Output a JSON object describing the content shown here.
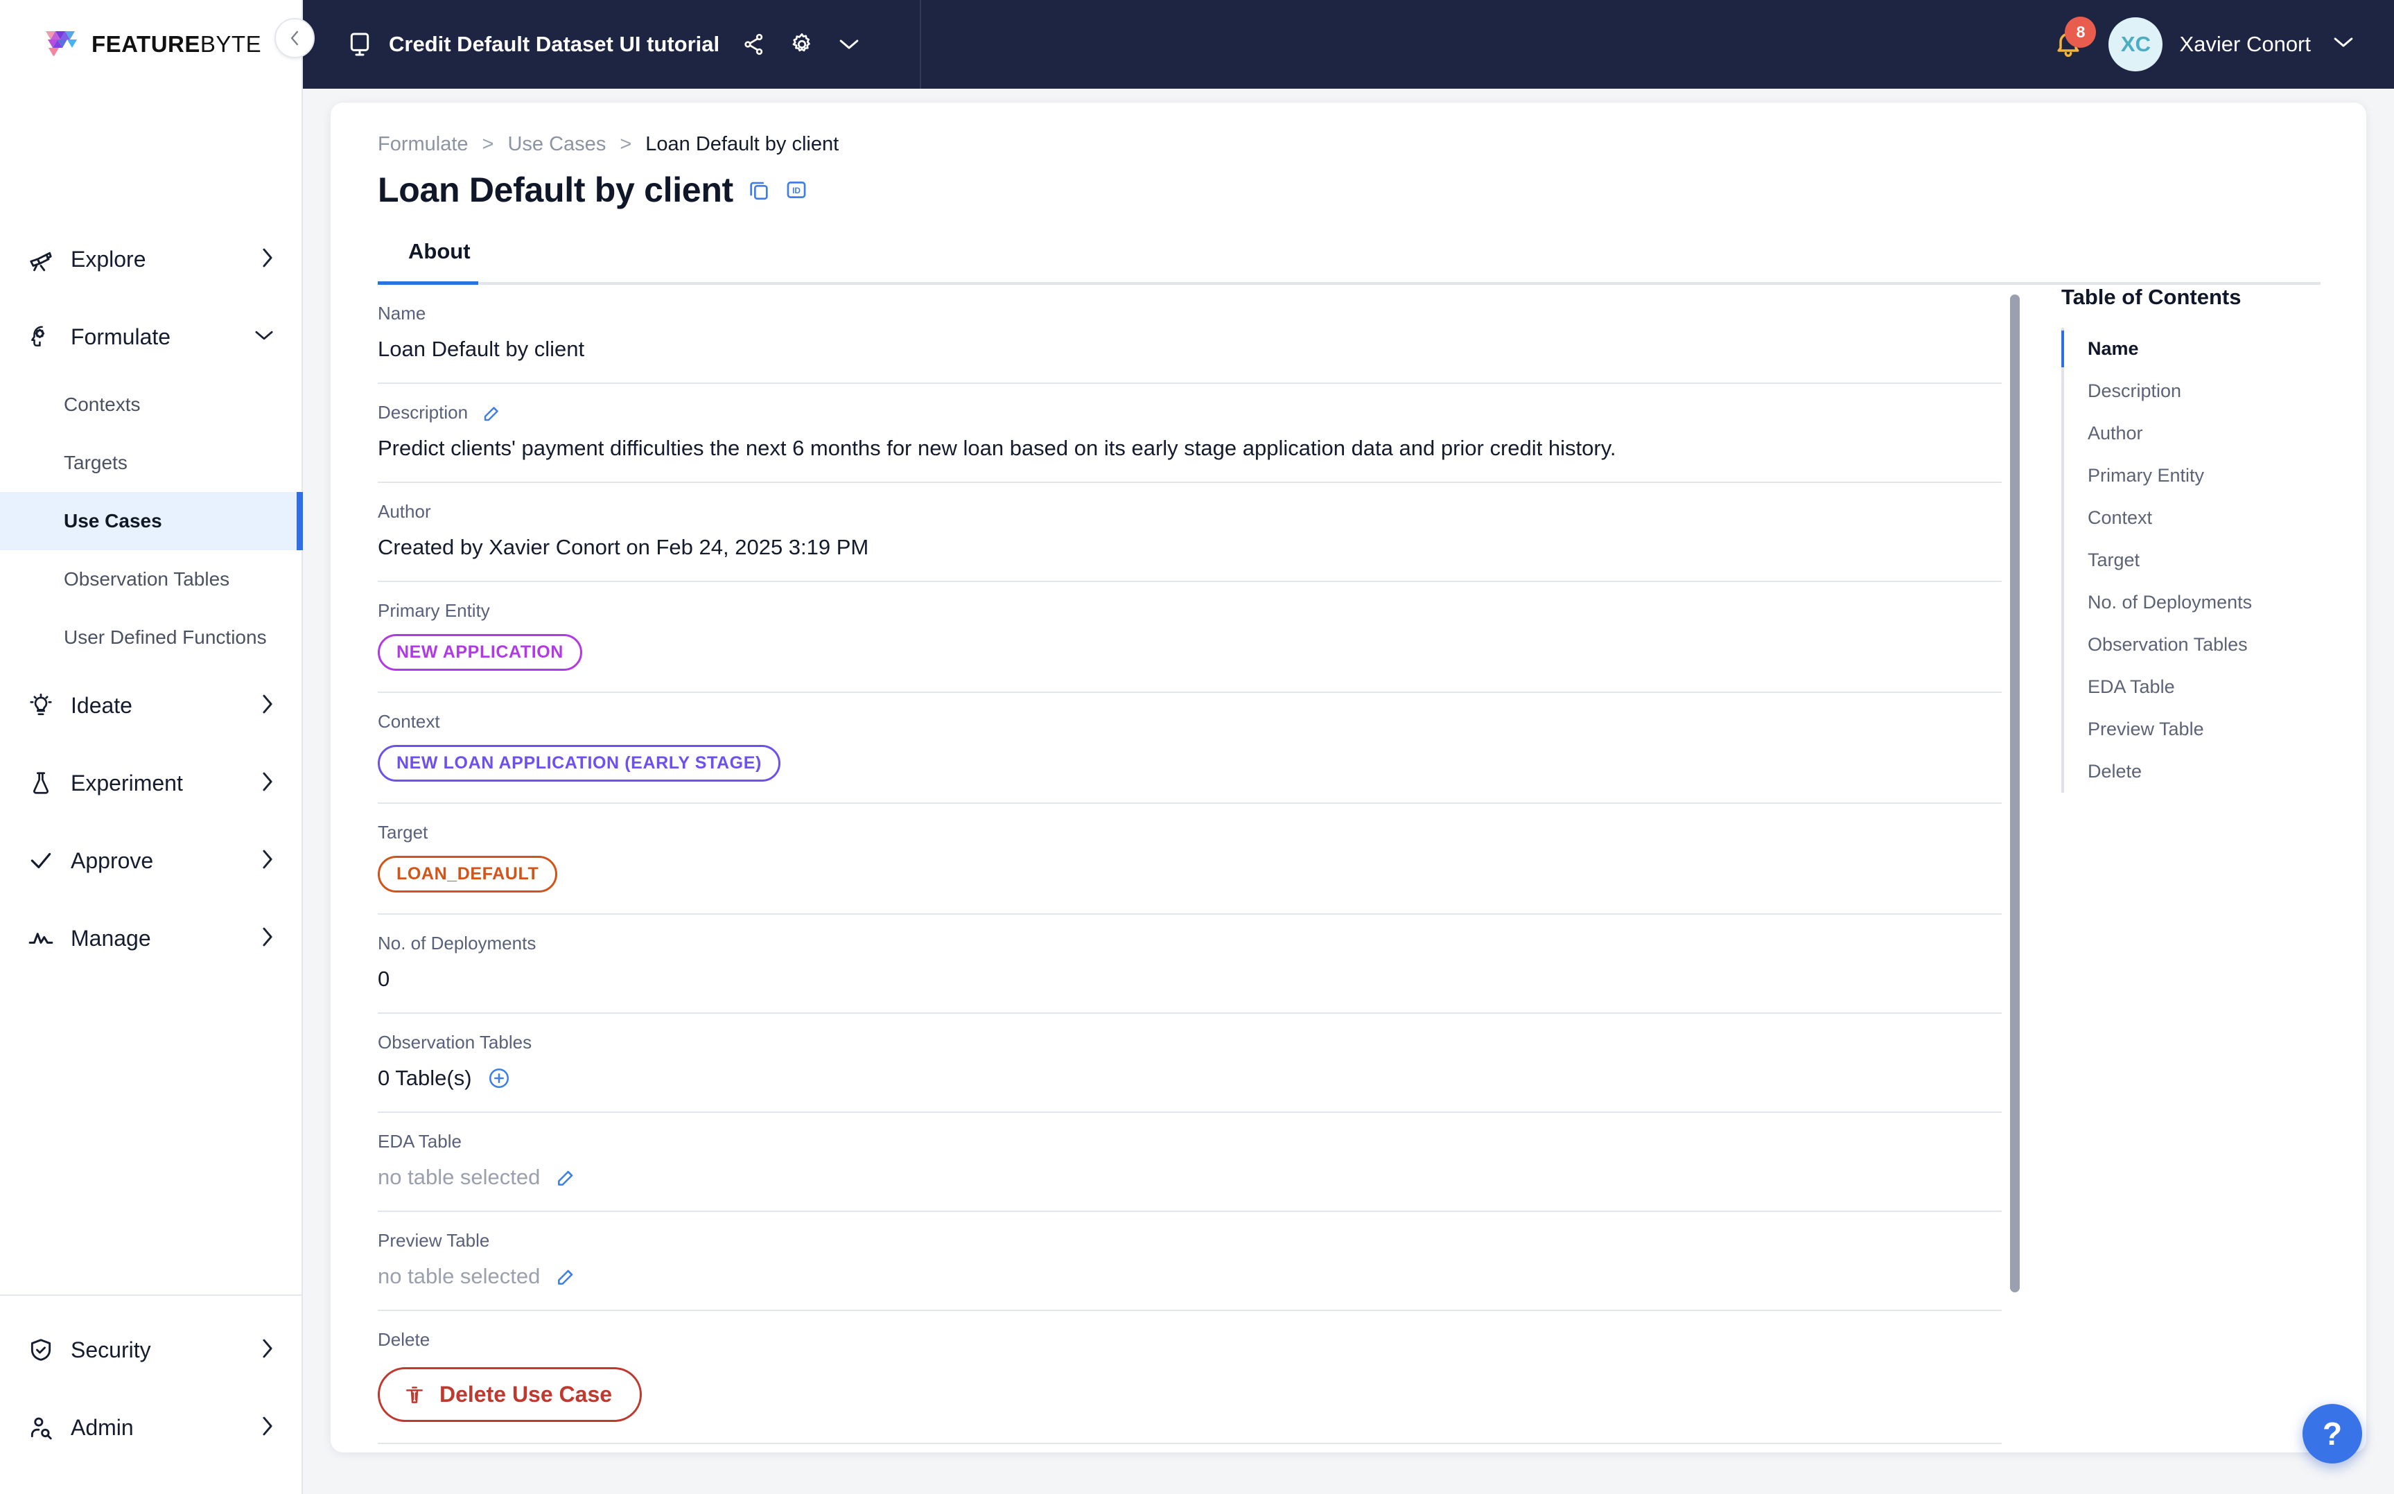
{
  "brand": {
    "name_bold": "FEATURE",
    "name_thin": "BYTE"
  },
  "topbar": {
    "workspace_title": "Credit Default Dataset UI tutorial",
    "monitor_icon": "monitor-icon",
    "share_icon": "share-icon",
    "gear_icon": "gear-icon",
    "chevron_icon": "chevron-down-icon",
    "notification_count": "8",
    "avatar_initials": "XC",
    "user_name": "Xavier Conort"
  },
  "sidebar": {
    "groups": [
      {
        "label": "Explore",
        "icon": "telescope-icon",
        "chevron": "›",
        "expanded": false
      },
      {
        "label": "Formulate",
        "icon": "head-gear-icon",
        "chevron": "⌄",
        "expanded": true
      }
    ],
    "formulate_children": [
      {
        "label": "Contexts",
        "active": false
      },
      {
        "label": "Targets",
        "active": false
      },
      {
        "label": "Use Cases",
        "active": true
      },
      {
        "label": "Observation Tables",
        "active": false
      },
      {
        "label": "User Defined Functions",
        "active": false
      }
    ],
    "groups_after": [
      {
        "label": "Ideate",
        "icon": "lightbulb-icon",
        "chevron": "›"
      },
      {
        "label": "Experiment",
        "icon": "flask-icon",
        "chevron": "›"
      },
      {
        "label": "Approve",
        "icon": "check-icon",
        "chevron": "›"
      },
      {
        "label": "Manage",
        "icon": "activity-icon",
        "chevron": "›"
      }
    ],
    "bottom": [
      {
        "label": "Security",
        "icon": "shield-check-icon",
        "chevron": "›"
      },
      {
        "label": "Admin",
        "icon": "user-search-icon",
        "chevron": "›"
      }
    ]
  },
  "breadcrumb": {
    "items": [
      "Formulate",
      "Use Cases"
    ],
    "current": "Loan Default by client",
    "separator": ">"
  },
  "page": {
    "title": "Loan Default by client",
    "copy_icon": "copy-icon",
    "id_icon": "id-badge-icon"
  },
  "tabs": [
    {
      "label": "About",
      "active": true
    }
  ],
  "fields": [
    {
      "id": "name",
      "label": "Name",
      "value": "Loan Default by client",
      "type": "text"
    },
    {
      "id": "description",
      "label": "Description",
      "label_icon": "edit-icon",
      "value": "Predict clients' payment difficulties the next 6 months for new loan based on its early stage application data and prior credit history.",
      "type": "text"
    },
    {
      "id": "author",
      "label": "Author",
      "value": "Created by Xavier Conort on Feb 24, 2025 3:19 PM",
      "type": "text"
    },
    {
      "id": "primary_entity",
      "label": "Primary Entity",
      "value": "NEW APPLICATION",
      "type": "pill",
      "pill_class": "entity"
    },
    {
      "id": "context",
      "label": "Context",
      "value": "NEW LOAN APPLICATION (EARLY STAGE)",
      "type": "pill",
      "pill_class": "context"
    },
    {
      "id": "target",
      "label": "Target",
      "value": "LOAN_DEFAULT",
      "type": "pill",
      "pill_class": "target"
    },
    {
      "id": "deployments",
      "label": "No. of Deployments",
      "value": "0",
      "type": "text"
    },
    {
      "id": "observation_tables",
      "label": "Observation Tables",
      "value": "0 Table(s)",
      "type": "text_plus",
      "plus_icon": "plus-circle-icon"
    },
    {
      "id": "eda_table",
      "label": "EDA Table",
      "value": "no table selected",
      "type": "text_edit",
      "muted": true,
      "edit_icon": "edit-icon"
    },
    {
      "id": "preview_table",
      "label": "Preview Table",
      "value": "no table selected",
      "type": "text_edit",
      "muted": true,
      "edit_icon": "edit-icon"
    },
    {
      "id": "delete",
      "label": "Delete",
      "value": "Delete Use Case",
      "type": "danger_button",
      "trash_icon": "trash-icon"
    }
  ],
  "toc": {
    "title": "Table of Contents",
    "items": [
      {
        "label": "Name",
        "active": true
      },
      {
        "label": "Description",
        "active": false
      },
      {
        "label": "Author",
        "active": false
      },
      {
        "label": "Primary Entity",
        "active": false
      },
      {
        "label": "Context",
        "active": false
      },
      {
        "label": "Target",
        "active": false
      },
      {
        "label": "No. of Deployments",
        "active": false
      },
      {
        "label": "Observation Tables",
        "active": false
      },
      {
        "label": "EDA Table",
        "active": false
      },
      {
        "label": "Preview Table",
        "active": false
      },
      {
        "label": "Delete",
        "active": false
      }
    ]
  },
  "help": {
    "label": "?"
  },
  "colors": {
    "accent": "#2f6fe4",
    "topbar_bg": "#1e2543",
    "entity": "#b13ae6",
    "context": "#6e50ef",
    "target": "#d35418",
    "danger": "#c0392f",
    "badge": "#e95d4e"
  }
}
